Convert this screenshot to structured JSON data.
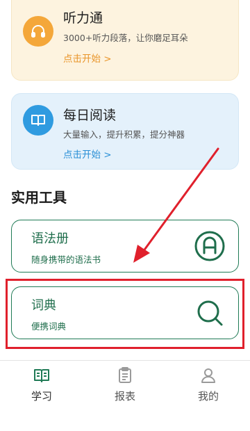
{
  "cards": [
    {
      "title": "听力通",
      "subtitle": "3000+听力段落，让你磨足耳朵",
      "link": "点击开始 >",
      "icon": "headphones-icon",
      "accent": "#f4a73a",
      "background": "#fdf3df"
    },
    {
      "title": "每日阅读",
      "subtitle": "大量输入，提升积累，提分神器",
      "link": "点击开始 >",
      "icon": "book-icon",
      "accent": "#2f9be0",
      "background": "#e4f1fb"
    }
  ],
  "section_title": "实用工具",
  "tools": [
    {
      "title": "语法册",
      "subtitle": "随身携带的语法书",
      "icon": "grammar-a-icon"
    },
    {
      "title": "词典",
      "subtitle": "便携词典",
      "icon": "search-icon"
    }
  ],
  "tool_color": "#1f7a55",
  "highlight_color": "#e0202c",
  "bottom_nav": [
    {
      "label": "学习",
      "icon": "book-open-icon",
      "active": true
    },
    {
      "label": "报表",
      "icon": "clipboard-icon",
      "active": false
    },
    {
      "label": "我的",
      "icon": "user-icon",
      "active": false
    }
  ]
}
